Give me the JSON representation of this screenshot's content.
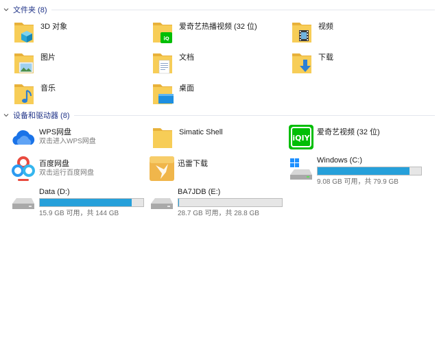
{
  "sections": {
    "folders": {
      "title": "文件夹 (8)"
    },
    "devices": {
      "title": "设备和驱动器 (8)"
    }
  },
  "folders": [
    {
      "label": "3D 对象"
    },
    {
      "label": "爱奇艺热播视频 (32 位)"
    },
    {
      "label": "视频"
    },
    {
      "label": "图片"
    },
    {
      "label": "文档"
    },
    {
      "label": "下载"
    },
    {
      "label": "音乐"
    },
    {
      "label": "桌面"
    }
  ],
  "devices": [
    {
      "label": "WPS网盘",
      "sub": "双击进入WPS网盘"
    },
    {
      "label": "Simatic Shell"
    },
    {
      "label": "爱奇艺视频 (32 位)"
    },
    {
      "label": "百度网盘",
      "sub": "双击运行百度网盘"
    },
    {
      "label": "迅雷下载"
    }
  ],
  "drives": [
    {
      "label": "Windows (C:)",
      "free_text": "9.08 GB 可用，共 79.9 GB",
      "used_fraction": 0.886
    },
    {
      "label": "Data (D:)",
      "free_text": "15.9 GB 可用，共 144 GB",
      "used_fraction": 0.89
    },
    {
      "label": "BA7JDB (E:)",
      "free_text": "28.7 GB 可用，共 28.8 GB",
      "used_fraction": 0.004
    }
  ],
  "colors": {
    "section_title": "#1e3287",
    "drive_bar_fill": "#26a0da",
    "folder_yellow": "#f5c342"
  }
}
